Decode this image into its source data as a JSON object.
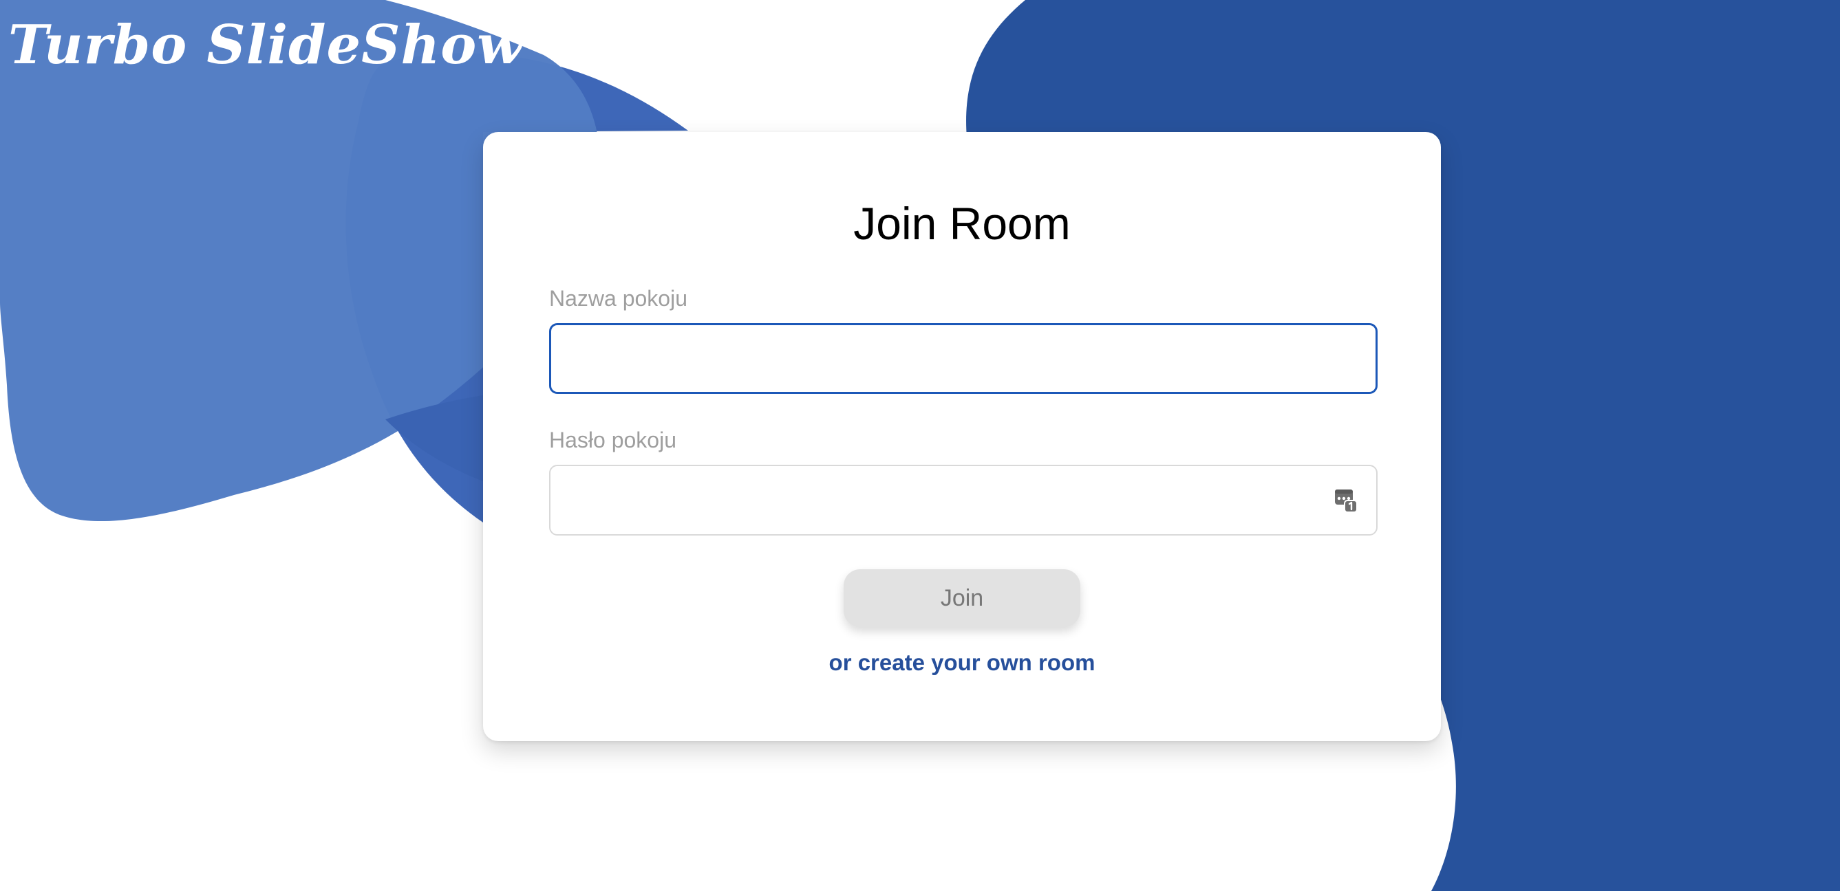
{
  "logo": {
    "text": "Turbo SlideShow"
  },
  "card": {
    "title": "Join Room",
    "room_name_label": "Nazwa pokoju",
    "room_name_value": "",
    "room_password_label": "Hasło pokoju",
    "room_password_value": "",
    "join_button_label": "Join",
    "create_room_link": "or create your own room"
  },
  "icons": {
    "password_field_icon": "password-key-icon"
  },
  "colors": {
    "brand_blue_light": "#527cc4",
    "brand_blue_mid": "#3e67b8",
    "brand_blue_dark": "#27529c",
    "focus_border": "#1c58b8",
    "link": "#264f9b",
    "button_bg": "#e2e2e2"
  }
}
